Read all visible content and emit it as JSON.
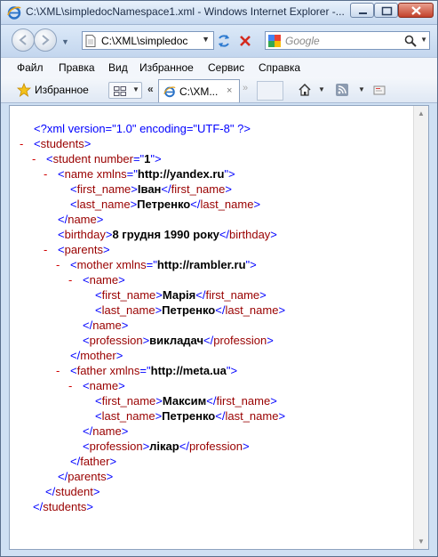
{
  "window": {
    "title": "C:\\XML\\simpledocNamespace1.xml - Windows Internet Explorer -..."
  },
  "address": {
    "value": "C:\\XML\\simpledoc"
  },
  "search": {
    "placeholder": "Google"
  },
  "menu": [
    "Файл",
    "Правка",
    "Вид",
    "Избранное",
    "Сервис",
    "Справка"
  ],
  "favorites": {
    "label": "Избранное"
  },
  "tab": {
    "title": "C:\\XM...",
    "close": "×"
  },
  "nav": {
    "tab_scroll_left": "«",
    "tab_scroll_right": "»"
  },
  "xml": {
    "declaration": "<?xml version=\"1.0\" encoding=\"UTF-8\" ?>",
    "root_tag": "students",
    "student": {
      "tag": "student",
      "attr": "number",
      "value": "1"
    },
    "name_ns": "http://yandex.ru",
    "first_name": "Іван",
    "last_name": "Петренко",
    "birthday": "8 грудня 1990 року",
    "parents_tag": "parents",
    "mother": {
      "ns": "http://rambler.ru",
      "first_name": "Марія",
      "last_name": "Петренко",
      "profession": "викладач"
    },
    "father": {
      "ns": "http://meta.ua",
      "first_name": "Максим",
      "last_name": "Петренко",
      "profession": "лікар"
    }
  },
  "colors": {
    "tag": "#990000",
    "bracket": "#0000ff",
    "collapse": "#d00000"
  }
}
